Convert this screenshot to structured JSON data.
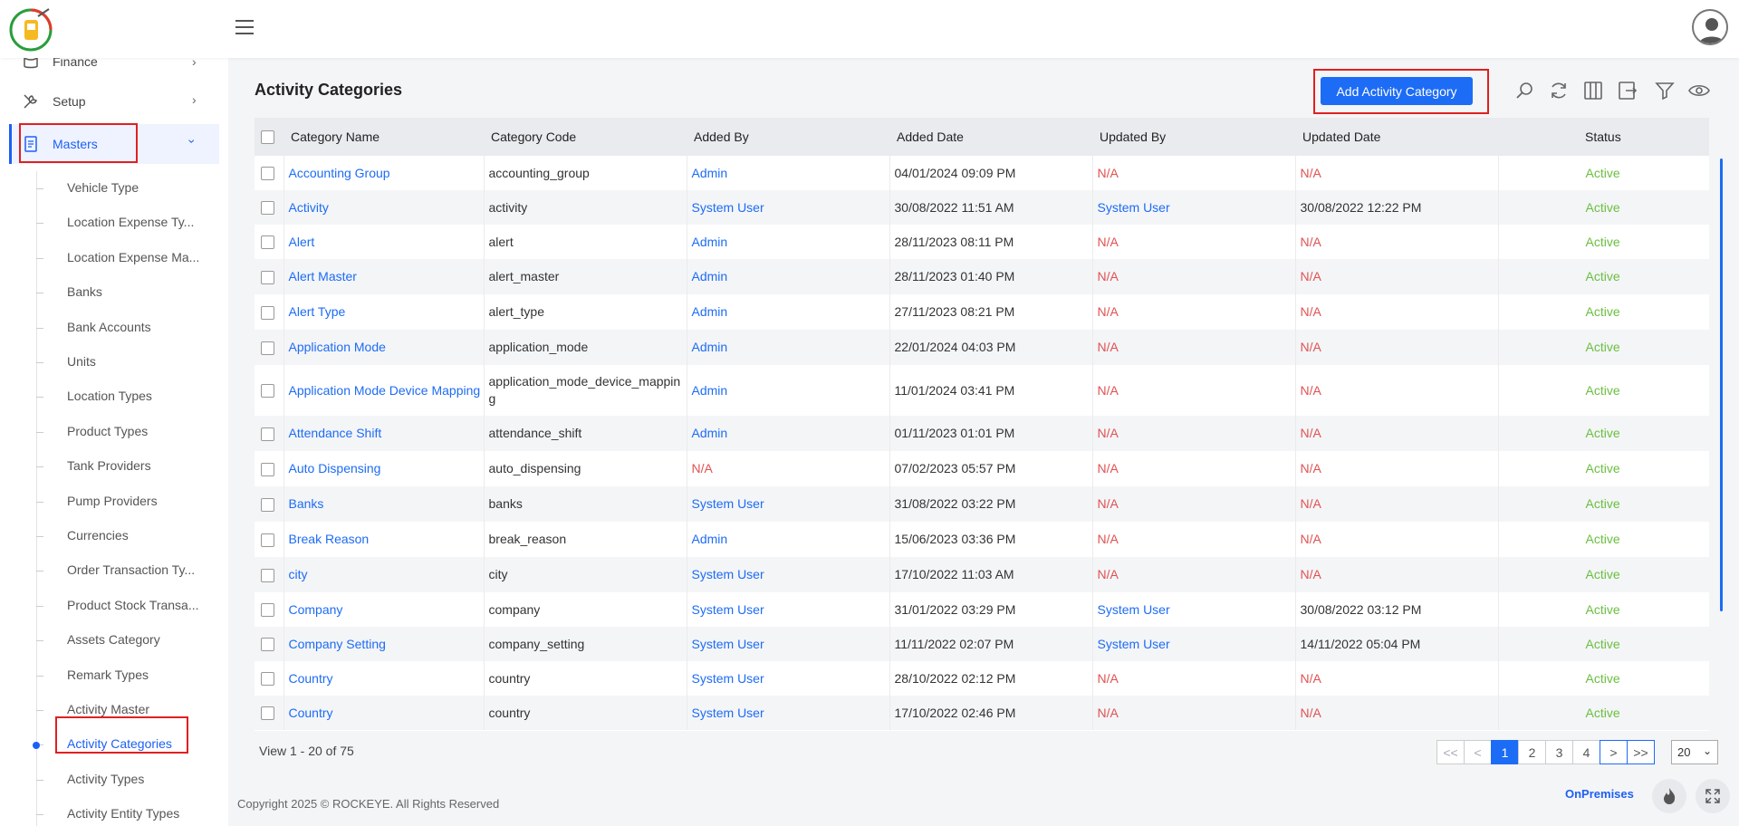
{
  "sidebar": {
    "top_items": [
      {
        "label": "Finance",
        "icon": "finance-icon"
      },
      {
        "label": "Setup",
        "icon": "tools-icon"
      },
      {
        "label": "Masters",
        "icon": "document-icon"
      }
    ],
    "sub_items": [
      "Vehicle Type",
      "Location Expense Ty...",
      "Location Expense Ma...",
      "Banks",
      "Bank Accounts",
      "Units",
      "Location Types",
      "Product Types",
      "Tank Providers",
      "Pump Providers",
      "Currencies",
      "Order Transaction Ty...",
      "Product Stock Transa...",
      "Assets Category",
      "Remark Types",
      "Activity Master",
      "Activity Categories",
      "Activity Types",
      "Activity Entity Types"
    ],
    "active_sub_item": "Activity Categories",
    "accent_color": "#1d5ff5"
  },
  "main": {
    "title": "Activity Categories",
    "add_button_label": "Add Activity Category",
    "toolbar_icons": [
      "search-icon",
      "refresh-icon",
      "columns-icon",
      "export-icon",
      "filter-icon",
      "eye-icon"
    ],
    "columns": [
      "Category Name",
      "Category Code",
      "Added By",
      "Added Date",
      "Updated By",
      "Updated Date",
      "Status"
    ],
    "rows": [
      [
        "Accounting Group",
        "accounting_group",
        "Admin",
        "04/01/2024 09:09 PM",
        "N/A",
        "N/A",
        "Active"
      ],
      [
        "Activity",
        "activity",
        "System User",
        "30/08/2022 11:51 AM",
        "System User",
        "30/08/2022 12:22 PM",
        "Active"
      ],
      [
        "Alert",
        "alert",
        "Admin",
        "28/11/2023 08:11 PM",
        "N/A",
        "N/A",
        "Active"
      ],
      [
        "Alert Master",
        "alert_master",
        "Admin",
        "28/11/2023 01:40 PM",
        "N/A",
        "N/A",
        "Active"
      ],
      [
        "Alert Type",
        "alert_type",
        "Admin",
        "27/11/2023 08:21 PM",
        "N/A",
        "N/A",
        "Active"
      ],
      [
        "Application Mode",
        "application_mode",
        "Admin",
        "22/01/2024 04:03 PM",
        "N/A",
        "N/A",
        "Active"
      ],
      [
        "Application Mode Device Mapping",
        "application_mode_device_mapping",
        "Admin",
        "11/01/2024 03:41 PM",
        "N/A",
        "N/A",
        "Active"
      ],
      [
        "Attendance Shift",
        "attendance_shift",
        "Admin",
        "01/11/2023 01:01 PM",
        "N/A",
        "N/A",
        "Active"
      ],
      [
        "Auto Dispensing",
        "auto_dispensing",
        "N/A",
        "07/02/2023 05:57 PM",
        "N/A",
        "N/A",
        "Active"
      ],
      [
        "Banks",
        "banks",
        "System User",
        "31/08/2022 03:22 PM",
        "N/A",
        "N/A",
        "Active"
      ],
      [
        "Break Reason",
        "break_reason",
        "Admin",
        "15/06/2023 03:36 PM",
        "N/A",
        "N/A",
        "Active"
      ],
      [
        "city",
        "city",
        "System User",
        "17/10/2022 11:03 AM",
        "N/A",
        "N/A",
        "Active"
      ],
      [
        "Company",
        "company",
        "System User",
        "31/01/2022 03:29 PM",
        "System User",
        "30/08/2022 03:12 PM",
        "Active"
      ],
      [
        "Company Setting",
        "company_setting",
        "System User",
        "11/11/2022 02:07 PM",
        "System User",
        "14/11/2022 05:04 PM",
        "Active"
      ],
      [
        "Country",
        "country",
        "System User",
        "28/10/2022 02:12 PM",
        "N/A",
        "N/A",
        "Active"
      ],
      [
        "Country",
        "country",
        "System User",
        "17/10/2022 02:46 PM",
        "N/A",
        "N/A",
        "Active"
      ]
    ],
    "view_info": "View 1 - 20 of 75",
    "pagination": {
      "first": "<<",
      "prev": "<",
      "pages": [
        "1",
        "2",
        "3",
        "4"
      ],
      "current": "1",
      "next": ">",
      "last": ">>",
      "page_size": "20"
    }
  },
  "footer": {
    "copyright": "Copyright 2025 © ROCKEYE. All Rights Reserved",
    "mode": "OnPremises"
  },
  "colors": {
    "primary": "#1d6cf5",
    "na": "#e05252",
    "active": "#6abf3f",
    "highlight_box": "#e02020"
  }
}
